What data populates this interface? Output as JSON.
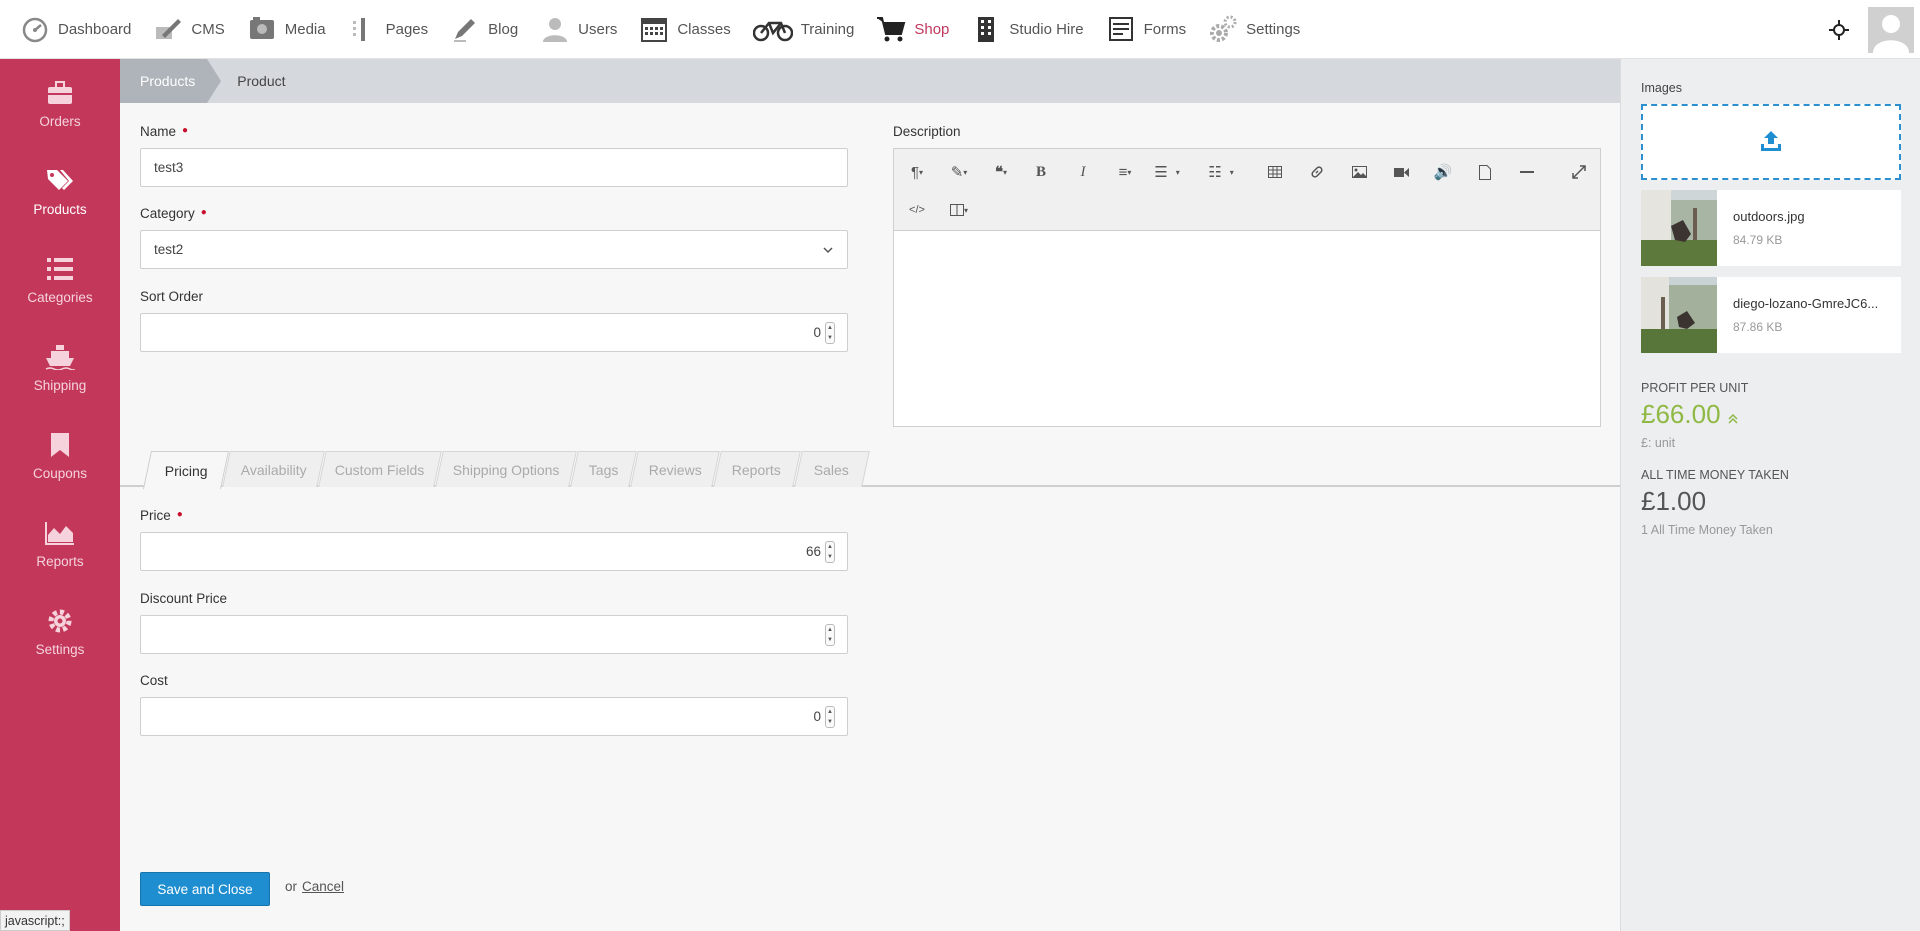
{
  "topnav": {
    "items": [
      {
        "label": "Dashboard",
        "icon": "dashboard-icon"
      },
      {
        "label": "CMS",
        "icon": "cms-icon"
      },
      {
        "label": "Media",
        "icon": "media-icon"
      },
      {
        "label": "Pages",
        "icon": "pages-icon"
      },
      {
        "label": "Blog",
        "icon": "blog-icon"
      },
      {
        "label": "Users",
        "icon": "users-icon"
      },
      {
        "label": "Classes",
        "icon": "calendar-icon"
      },
      {
        "label": "Training",
        "icon": "bicycle-icon"
      },
      {
        "label": "Shop",
        "icon": "cart-icon",
        "active": true
      },
      {
        "label": "Studio Hire",
        "icon": "building-icon"
      },
      {
        "label": "Forms",
        "icon": "forms-icon"
      },
      {
        "label": "Settings",
        "icon": "gears-icon"
      }
    ],
    "active_color": "#c0385c"
  },
  "sidebar": {
    "color": "#c3375a",
    "items": [
      {
        "label": "Orders",
        "icon": "briefcase-icon"
      },
      {
        "label": "Products",
        "icon": "tags-icon",
        "active": true
      },
      {
        "label": "Categories",
        "icon": "list-icon"
      },
      {
        "label": "Shipping",
        "icon": "ship-icon"
      },
      {
        "label": "Coupons",
        "icon": "bookmark-icon"
      },
      {
        "label": "Reports",
        "icon": "area-chart-icon"
      },
      {
        "label": "Settings",
        "icon": "gear-icon"
      }
    ]
  },
  "breadcrumb": {
    "first": "Products",
    "second": "Product"
  },
  "form": {
    "name_label": "Name",
    "name_value": "test3",
    "category_label": "Category",
    "category_value": "test2",
    "sort_order_label": "Sort Order",
    "sort_order_value": "0",
    "description_label": "Description"
  },
  "tabs": [
    "Pricing",
    "Availability",
    "Custom Fields",
    "Shipping Options",
    "Tags",
    "Reviews",
    "Reports",
    "Sales"
  ],
  "active_tab": "Pricing",
  "pricing": {
    "price_label": "Price",
    "price_value": "66",
    "discount_label": "Discount Price",
    "discount_value": "",
    "cost_label": "Cost",
    "cost_value": "0"
  },
  "actions": {
    "save_label": "Save and Close",
    "or_text": "or",
    "cancel_label": "Cancel"
  },
  "images_panel": {
    "title": "Images",
    "images": [
      {
        "name": "outdoors.jpg",
        "size": "84.79 KB"
      },
      {
        "name": "diego-lozano-GmreJC6...",
        "size": "87.86 KB"
      }
    ]
  },
  "stats": {
    "profit_label": "PROFIT PER UNIT",
    "profit_value": "£66.00",
    "profit_color": "#8fb944",
    "profit_sub": "£: unit",
    "money_label": "ALL TIME MONEY TAKEN",
    "money_value": "£1.00",
    "money_sub": "1 All Time Money Taken"
  },
  "status_bar": "javascript:;"
}
